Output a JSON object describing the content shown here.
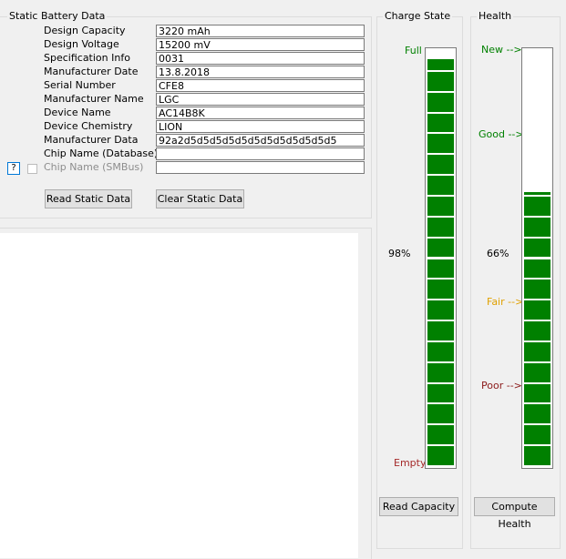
{
  "static_group": {
    "title": "Static Battery Data",
    "fields": [
      {
        "label": "Design Capacity",
        "value": "3220 mAh"
      },
      {
        "label": "Design Voltage",
        "value": "15200 mV"
      },
      {
        "label": "Specification Info",
        "value": "0031"
      },
      {
        "label": "Manufacturer Date",
        "value": "13.8.2018"
      },
      {
        "label": "Serial Number",
        "value": "CFE8"
      },
      {
        "label": "Manufacturer Name",
        "value": "LGC"
      },
      {
        "label": "Device Name",
        "value": "AC14B8K"
      },
      {
        "label": "Device Chemistry",
        "value": "LION"
      },
      {
        "label": "Manufacturer Data",
        "value": "92a2d5d5d5d5d5d5d5d5d5d5d5d5"
      },
      {
        "label": "Chip Name (Database)",
        "value": ""
      },
      {
        "label": "Chip Name (SMBus)",
        "value": "",
        "disabled": true
      }
    ],
    "help_label": "?",
    "read_button": "Read Static Data",
    "clear_button": "Clear Static Data"
  },
  "charge_group": {
    "title": "Charge State",
    "label_full": "Full",
    "label_empty": "Empty",
    "percent_text": "98%",
    "level_fraction": 0.98,
    "segments": 20,
    "color_full": "#008000",
    "color_empty": "#a52a2a",
    "button": "Read Capacity"
  },
  "health_group": {
    "title": "Health",
    "label_new": "New -->",
    "label_good": "Good -->",
    "label_fair": "Fair -->",
    "label_poor": "Poor -->",
    "percent_text": "66%",
    "level_fraction": 0.66,
    "segments": 20,
    "color_new": "#008000",
    "color_good": "#008000",
    "color_fair": "#e0a000",
    "color_poor": "#8b1a1a",
    "button": "Compute Health"
  },
  "colors": {
    "bar_fill": "#008000"
  }
}
